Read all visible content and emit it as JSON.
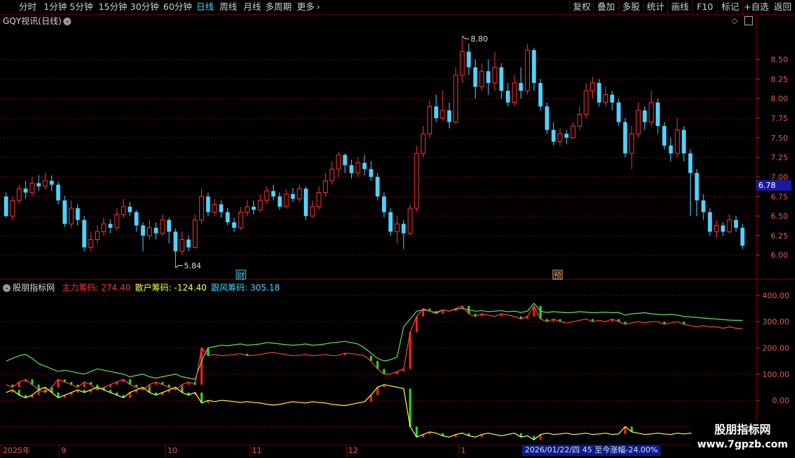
{
  "toolbar": {
    "timeframes": [
      "分时",
      "1分钟",
      "5分钟",
      "15分钟",
      "30分钟",
      "60分钟",
      "日线",
      "周线",
      "月线",
      "多周期",
      "更多"
    ],
    "active_timeframe": "日线",
    "more_arrow": "›",
    "right_buttons": [
      "复权",
      "叠加",
      "多股",
      "统计",
      "画线",
      "F10",
      "标记",
      "+自选",
      "返回"
    ]
  },
  "main_panel": {
    "title": "GQY视讯(日线)",
    "high_label": "8.80",
    "low_label": "5.84",
    "current_price": "6.78",
    "price_axis": [
      "8.50",
      "8.25",
      "8.00",
      "7.75",
      "7.50",
      "7.25",
      "7.00",
      "6.75",
      "6.50",
      "6.25",
      "6.00"
    ],
    "event_tags": [
      "财",
      "预"
    ]
  },
  "indicator_panel": {
    "name": "股朋指标网",
    "series": [
      {
        "label": "主力筹码:",
        "value": "274.40",
        "color": "#ff3030"
      },
      {
        "label": "散户筹码:",
        "value": "-124.40",
        "color": "#ffff40"
      },
      {
        "label": "跟风筹码:",
        "value": "305.18",
        "color": "#4fd2ff"
      }
    ],
    "axis": [
      "400.00",
      "300.00",
      "200.00",
      "100.00",
      "0.00",
      "-100.00"
    ]
  },
  "date_axis": {
    "labels": [
      "2025年",
      "9",
      "10",
      "11",
      "12",
      "1"
    ]
  },
  "status_bar": {
    "text": "2026/01/22/四 45 至今涨幅-24.00%"
  },
  "watermark": {
    "line1": "股朋指标网",
    "line2": "www.7gpzb.com"
  },
  "colors": {
    "up": "#ff3333",
    "down": "#4fd2ff",
    "grid": "#8a0000",
    "axis_text": "#e05a5a",
    "active": "#4fd2ff"
  },
  "chart_data": {
    "type": "candlestick",
    "price_ylim": [
      5.8,
      8.9
    ],
    "candles": [
      [
        6.75,
        6.5,
        6.8,
        6.48
      ],
      [
        6.5,
        6.7,
        6.75,
        6.45
      ],
      [
        6.7,
        6.85,
        6.9,
        6.65
      ],
      [
        6.85,
        6.8,
        6.95,
        6.72
      ],
      [
        6.8,
        6.92,
        7.0,
        6.76
      ],
      [
        6.92,
        6.88,
        7.02,
        6.82
      ],
      [
        6.88,
        6.95,
        7.05,
        6.84
      ],
      [
        6.95,
        6.9,
        7.02,
        6.82
      ],
      [
        6.9,
        6.7,
        6.94,
        6.65
      ],
      [
        6.7,
        6.4,
        6.76,
        6.36
      ],
      [
        6.4,
        6.6,
        6.7,
        6.35
      ],
      [
        6.6,
        6.45,
        6.65,
        6.38
      ],
      [
        6.45,
        6.1,
        6.5,
        6.05
      ],
      [
        6.1,
        6.2,
        6.3,
        6.05
      ],
      [
        6.2,
        6.3,
        6.38,
        6.15
      ],
      [
        6.3,
        6.4,
        6.48,
        6.25
      ],
      [
        6.4,
        6.35,
        6.46,
        6.28
      ],
      [
        6.35,
        6.52,
        6.6,
        6.32
      ],
      [
        6.52,
        6.62,
        6.72,
        6.48
      ],
      [
        6.62,
        6.55,
        6.68,
        6.5
      ],
      [
        6.55,
        6.38,
        6.58,
        6.3
      ],
      [
        6.38,
        6.25,
        6.42,
        6.05
      ],
      [
        6.25,
        6.35,
        6.45,
        6.2
      ],
      [
        6.35,
        6.28,
        6.42,
        6.2
      ],
      [
        6.28,
        6.45,
        6.52,
        6.25
      ],
      [
        6.45,
        6.3,
        6.48,
        6.15
      ],
      [
        6.3,
        6.05,
        6.34,
        5.84
      ],
      [
        6.05,
        6.2,
        6.3,
        6.0
      ],
      [
        6.2,
        6.1,
        6.25,
        6.05
      ],
      [
        6.1,
        6.45,
        6.52,
        6.08
      ],
      [
        6.45,
        6.75,
        6.85,
        6.4
      ],
      [
        6.75,
        6.55,
        6.8,
        6.5
      ],
      [
        6.55,
        6.65,
        6.72,
        6.5
      ],
      [
        6.65,
        6.55,
        6.7,
        6.48
      ],
      [
        6.55,
        6.42,
        6.6,
        6.38
      ],
      [
        6.42,
        6.35,
        6.48,
        6.3
      ],
      [
        6.35,
        6.55,
        6.62,
        6.32
      ],
      [
        6.55,
        6.62,
        6.7,
        6.5
      ],
      [
        6.62,
        6.58,
        6.7,
        6.52
      ],
      [
        6.58,
        6.7,
        6.78,
        6.55
      ],
      [
        6.7,
        6.82,
        6.88,
        6.65
      ],
      [
        6.82,
        6.75,
        6.9,
        6.7
      ],
      [
        6.75,
        6.62,
        6.8,
        6.58
      ],
      [
        6.62,
        6.78,
        6.84,
        6.6
      ],
      [
        6.78,
        6.72,
        6.86,
        6.68
      ],
      [
        6.72,
        6.85,
        6.9,
        6.68
      ],
      [
        6.85,
        6.5,
        6.88,
        6.45
      ],
      [
        6.5,
        6.62,
        6.7,
        6.48
      ],
      [
        6.62,
        6.8,
        6.88,
        6.58
      ],
      [
        6.8,
        6.95,
        7.05,
        6.75
      ],
      [
        6.95,
        7.1,
        7.2,
        6.9
      ],
      [
        7.1,
        7.28,
        7.32,
        7.0
      ],
      [
        7.28,
        7.15,
        7.3,
        7.05
      ],
      [
        7.15,
        7.05,
        7.22,
        6.98
      ],
      [
        7.05,
        7.18,
        7.25,
        7.0
      ],
      [
        7.18,
        7.1,
        7.28,
        7.02
      ],
      [
        7.1,
        7.0,
        7.2,
        6.95
      ],
      [
        7.0,
        6.75,
        7.05,
        6.7
      ],
      [
        6.75,
        6.55,
        6.8,
        6.48
      ],
      [
        6.55,
        6.3,
        6.6,
        6.25
      ],
      [
        6.3,
        6.4,
        6.5,
        6.15
      ],
      [
        6.4,
        6.28,
        6.45,
        6.08
      ],
      [
        6.28,
        6.6,
        6.65,
        6.25
      ],
      [
        6.6,
        7.3,
        7.4,
        6.55
      ],
      [
        7.3,
        7.55,
        7.65,
        7.25
      ],
      [
        7.55,
        7.9,
        7.98,
        7.5
      ],
      [
        7.9,
        7.75,
        8.05,
        7.7
      ],
      [
        7.75,
        7.85,
        8.1,
        7.72
      ],
      [
        7.85,
        7.7,
        7.95,
        7.62
      ],
      [
        7.7,
        8.3,
        8.4,
        7.68
      ],
      [
        8.3,
        8.6,
        8.8,
        8.2
      ],
      [
        8.6,
        8.4,
        8.7,
        8.3
      ],
      [
        8.4,
        8.15,
        8.5,
        8.0
      ],
      [
        8.15,
        8.35,
        8.45,
        8.1
      ],
      [
        8.35,
        8.2,
        8.5,
        8.05
      ],
      [
        8.2,
        8.4,
        8.6,
        8.1
      ],
      [
        8.4,
        8.1,
        8.45,
        8.0
      ],
      [
        8.1,
        7.95,
        8.2,
        7.9
      ],
      [
        7.95,
        8.2,
        8.3,
        7.9
      ],
      [
        8.2,
        8.1,
        8.4,
        8.0
      ],
      [
        8.1,
        8.62,
        8.7,
        8.05
      ],
      [
        8.62,
        8.2,
        8.65,
        8.1
      ],
      [
        8.2,
        7.9,
        8.25,
        7.85
      ],
      [
        7.9,
        7.6,
        7.95,
        7.55
      ],
      [
        7.6,
        7.45,
        7.7,
        7.4
      ],
      [
        7.45,
        7.55,
        7.62,
        7.4
      ],
      [
        7.55,
        7.5,
        7.6,
        7.42
      ],
      [
        7.5,
        7.65,
        7.7,
        7.48
      ],
      [
        7.65,
        7.8,
        7.9,
        7.6
      ],
      [
        7.8,
        8.1,
        8.2,
        7.75
      ],
      [
        8.1,
        8.2,
        8.28,
        8.0
      ],
      [
        8.2,
        7.95,
        8.25,
        7.9
      ],
      [
        7.95,
        8.05,
        8.15,
        7.9
      ],
      [
        8.05,
        7.95,
        8.1,
        7.85
      ],
      [
        7.95,
        7.7,
        8.0,
        7.65
      ],
      [
        7.7,
        7.3,
        7.75,
        7.25
      ],
      [
        7.3,
        7.55,
        7.65,
        7.1
      ],
      [
        7.55,
        7.85,
        7.95,
        7.5
      ],
      [
        7.85,
        7.7,
        7.9,
        7.6
      ],
      [
        7.7,
        7.95,
        8.1,
        7.65
      ],
      [
        7.95,
        7.65,
        8.0,
        7.55
      ],
      [
        7.65,
        7.4,
        7.7,
        7.35
      ],
      [
        7.4,
        7.3,
        7.5,
        7.2
      ],
      [
        7.3,
        7.6,
        7.75,
        7.25
      ],
      [
        7.6,
        7.3,
        7.65,
        7.2
      ],
      [
        7.3,
        7.05,
        7.35,
        6.5
      ],
      [
        7.05,
        6.7,
        7.1,
        6.5
      ],
      [
        6.7,
        6.55,
        6.78,
        6.45
      ],
      [
        6.55,
        6.3,
        6.6,
        6.25
      ],
      [
        6.3,
        6.38,
        6.45,
        6.22
      ],
      [
        6.38,
        6.3,
        6.42,
        6.25
      ],
      [
        6.3,
        6.45,
        6.52,
        6.28
      ],
      [
        6.45,
        6.35,
        6.5,
        6.3
      ],
      [
        6.35,
        6.12,
        6.4,
        6.08
      ]
    ],
    "indicator_ylim": [
      -150,
      440
    ],
    "indicator": {
      "main": [
        60,
        50,
        70,
        80,
        60,
        40,
        30,
        50,
        80,
        70,
        60,
        50,
        70,
        60,
        40,
        50,
        60,
        70,
        80,
        60,
        50,
        40,
        60,
        70,
        60,
        50,
        40,
        60,
        70,
        60,
        200,
        170,
        175,
        170,
        172,
        175,
        178,
        170,
        172,
        175,
        180,
        182,
        178,
        175,
        170,
        172,
        175,
        170,
        172,
        175,
        170,
        172,
        180,
        178,
        175,
        170,
        150,
        120,
        100,
        100,
        110,
        120,
        260,
        320,
        350,
        340,
        330,
        345,
        340,
        350,
        360,
        330,
        320,
        330,
        325,
        320,
        330,
        325,
        320,
        310,
        320,
        360,
        310,
        300,
        310,
        300,
        295,
        300,
        305,
        310,
        300,
        305,
        300,
        310,
        300,
        290,
        295,
        300,
        295,
        300,
        300,
        290,
        295,
        300,
        290,
        285,
        280,
        285,
        280,
        280,
        275,
        280,
        275,
        274
      ],
      "retail": [
        30,
        40,
        20,
        10,
        20,
        40,
        50,
        30,
        10,
        20,
        30,
        40,
        30,
        40,
        50,
        40,
        30,
        20,
        10,
        30,
        40,
        50,
        30,
        20,
        30,
        40,
        50,
        30,
        20,
        30,
        -10,
        0,
        -5,
        0,
        -2,
        -5,
        -8,
        -5,
        -8,
        -10,
        -15,
        -18,
        -15,
        -10,
        -5,
        -8,
        -10,
        -5,
        -8,
        -10,
        -15,
        -18,
        -20,
        -15,
        -10,
        -5,
        20,
        50,
        60,
        55,
        50,
        45,
        -100,
        -140,
        -130,
        -120,
        -125,
        -135,
        -140,
        -130,
        -125,
        -135,
        -140,
        -130,
        -125,
        -130,
        -135,
        -130,
        -125,
        -140,
        -135,
        -150,
        -130,
        -125,
        -130,
        -128,
        -125,
        -130,
        -128,
        -125,
        -130,
        -128,
        -125,
        -130,
        -128,
        -100,
        -120,
        -125,
        -130,
        -128,
        -125,
        -128,
        -130,
        -125,
        -128,
        -125,
        -130,
        -128,
        -125,
        -124,
        -125,
        -124,
        -124,
        -124
      ],
      "follow": [
        150,
        160,
        170,
        175,
        160,
        140,
        130,
        120,
        110,
        115,
        110,
        105,
        100,
        110,
        120,
        115,
        110,
        105,
        100,
        90,
        95,
        100,
        90,
        85,
        90,
        95,
        100,
        90,
        85,
        80,
        150,
        200,
        205,
        210,
        208,
        212,
        215,
        210,
        212,
        215,
        220,
        218,
        215,
        212,
        210,
        212,
        215,
        210,
        212,
        215,
        220,
        222,
        225,
        220,
        215,
        200,
        180,
        160,
        150,
        155,
        165,
        280,
        310,
        340,
        345,
        340,
        335,
        345,
        340,
        348,
        350,
        345,
        340,
        342,
        338,
        340,
        342,
        338,
        340,
        335,
        340,
        370,
        340,
        335,
        338,
        336,
        334,
        335,
        338,
        336,
        334,
        335,
        336,
        334,
        335,
        325,
        330,
        332,
        334,
        330,
        328,
        326,
        328,
        325,
        320,
        318,
        316,
        314,
        312,
        310,
        308,
        306,
        305,
        305
      ]
    },
    "date_labels": [
      "2025年",
      "9",
      "10",
      "11",
      "12",
      "1"
    ]
  }
}
